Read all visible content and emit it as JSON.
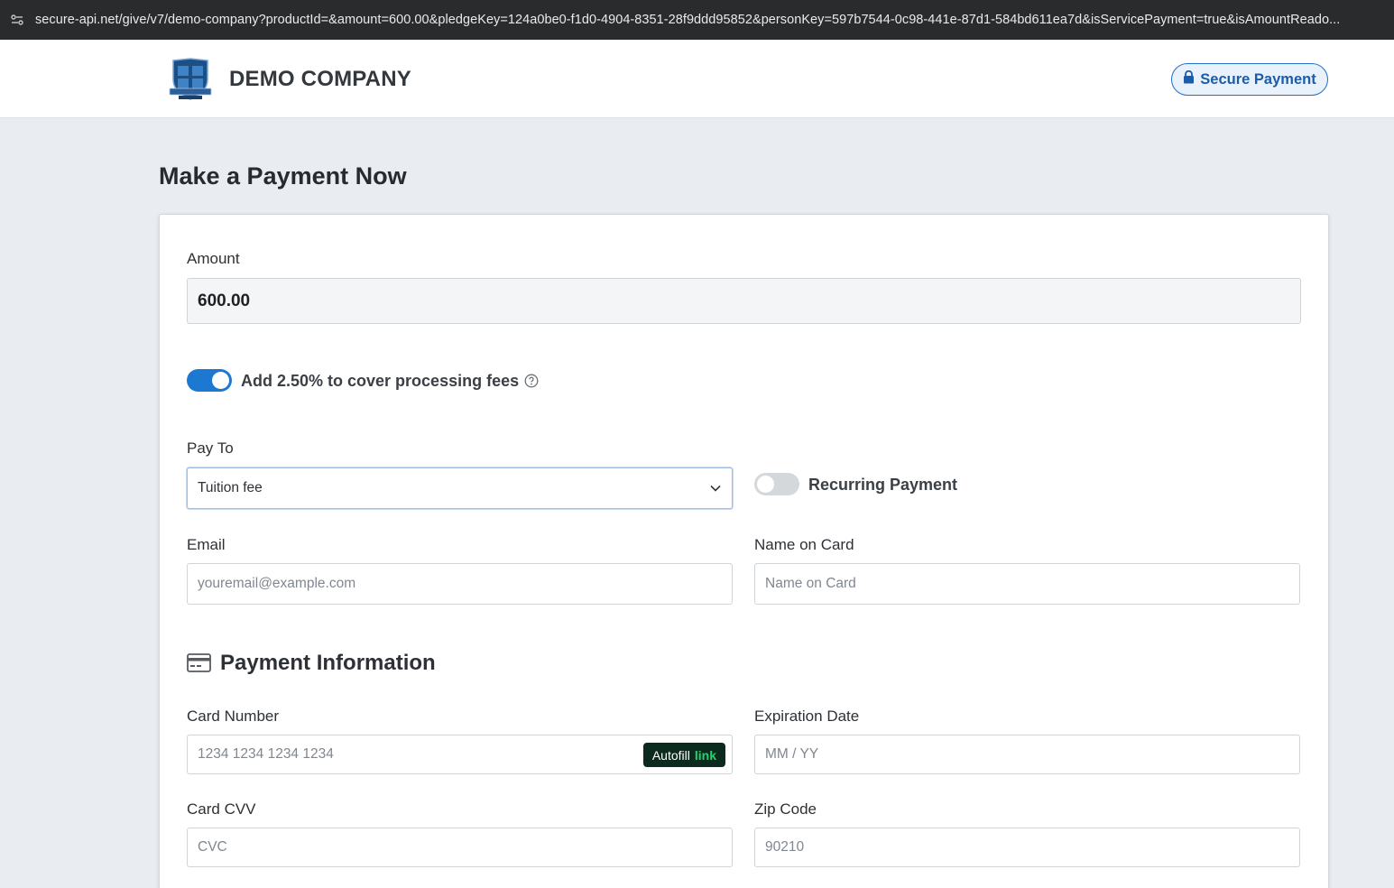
{
  "browser": {
    "url": "secure-api.net/give/v7/demo-company?productId=&amount=600.00&pledgeKey=124a0be0-f1d0-4904-8351-28f9ddd95852&personKey=597b7544-0c98-441e-87d1-584bd611ea7d&isServicePayment=true&isAmountReado..."
  },
  "header": {
    "company_name": "DEMO COMPANY",
    "secure_button_label": "Secure Payment"
  },
  "page": {
    "title": "Make a Payment Now"
  },
  "form": {
    "amount_label": "Amount",
    "amount_value": "600.00",
    "fee_toggle_label": "Add 2.50% to cover processing fees",
    "fee_toggle_on": true,
    "pay_to_label": "Pay To",
    "pay_to_value": "Tuition fee",
    "recurring_label": "Recurring Payment",
    "recurring_on": false,
    "email_label": "Email",
    "email_placeholder": "youremail@example.com",
    "name_label": "Name on Card",
    "name_placeholder": "Name on Card"
  },
  "payment_info": {
    "section_title": "Payment Information",
    "card_number_label": "Card Number",
    "card_number_placeholder": "1234 1234 1234 1234",
    "autofill_text": "Autofill",
    "autofill_link": "link",
    "expiration_label": "Expiration Date",
    "expiration_placeholder": "MM / YY",
    "cvv_label": "Card CVV",
    "cvv_placeholder": "CVC",
    "zip_label": "Zip Code",
    "zip_placeholder": "90210"
  },
  "colors": {
    "accent": "#1d78d2",
    "link_green": "#22d46b"
  },
  "icons": {
    "url_icon": "site-settings-icon",
    "lock": "lock-icon",
    "help": "help-circle-icon",
    "chevron": "chevron-down-icon",
    "card": "credit-card-icon"
  }
}
